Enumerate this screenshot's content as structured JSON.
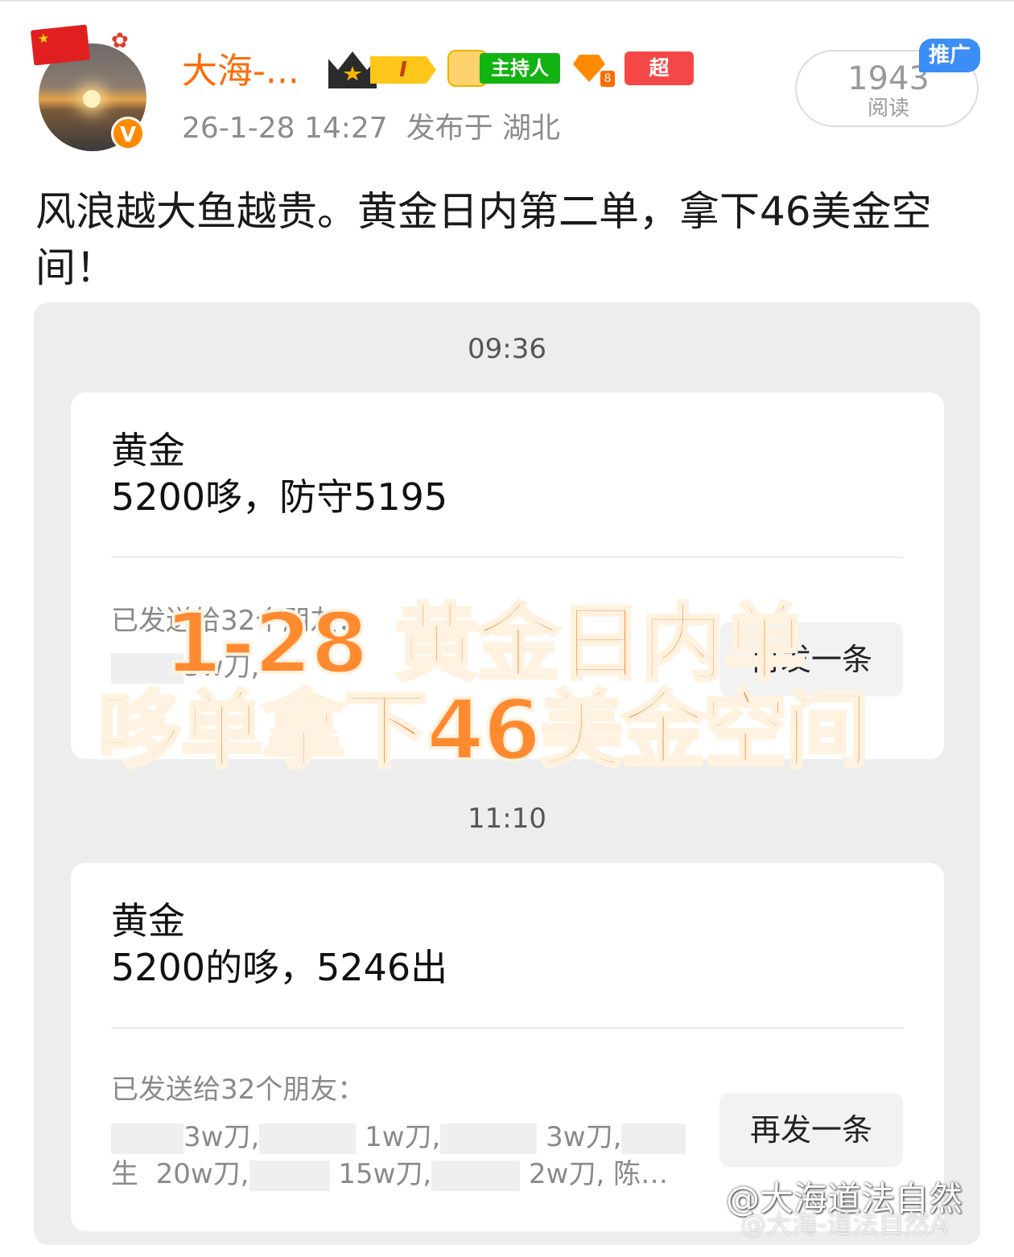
{
  "user": {
    "name": "大海-...",
    "level_badge": "I",
    "host_badge": "主持人",
    "diamond_level": "8",
    "superlike_badge": "超LIKE",
    "verified_mark": "V",
    "timestamp": "26-1-28 14:27",
    "location": "发布于 湖北"
  },
  "stats": {
    "reads": "1943",
    "reads_label": "阅读",
    "promo_tag": "推广"
  },
  "post": {
    "text": "风浪越大鱼越贵。黄金日内第二单，拿下46美金空间！"
  },
  "messages": [
    {
      "time": "09:36",
      "title": "黄金",
      "body": "5200哆，防守5195",
      "sent_to": "已发送给32个朋友：",
      "friends_line1": "3w刀,",
      "friends_line2": "",
      "resend": "再发一条"
    },
    {
      "time": "11:10",
      "title": "黄金",
      "body": "5200的哆，5246出",
      "sent_to": "已发送给32个朋友：",
      "friends_line1": [
        "3w刀,",
        "1w刀,",
        "3w刀,"
      ],
      "friends_line2": [
        "生  20w刀,",
        "15w刀,",
        "2w刀, 陈…"
      ],
      "resend": "再发一条"
    }
  ],
  "overlay": {
    "line1": "1-28 黄金日内单",
    "line2": "哆单拿下46美金空间"
  },
  "watermark": {
    "main": "@大海道法自然",
    "sub": "@大海-道法自然A"
  },
  "colors": {
    "username": "#ff6a00",
    "overlay_text": "#ff8a30",
    "promo": "#3a8ef5",
    "host_badge": "#12b312",
    "superlike": "#f44848"
  },
  "icons": [
    "china-flag-icon",
    "verified-icon",
    "crown-icon",
    "host-badge-icon",
    "diamond-icon"
  ]
}
